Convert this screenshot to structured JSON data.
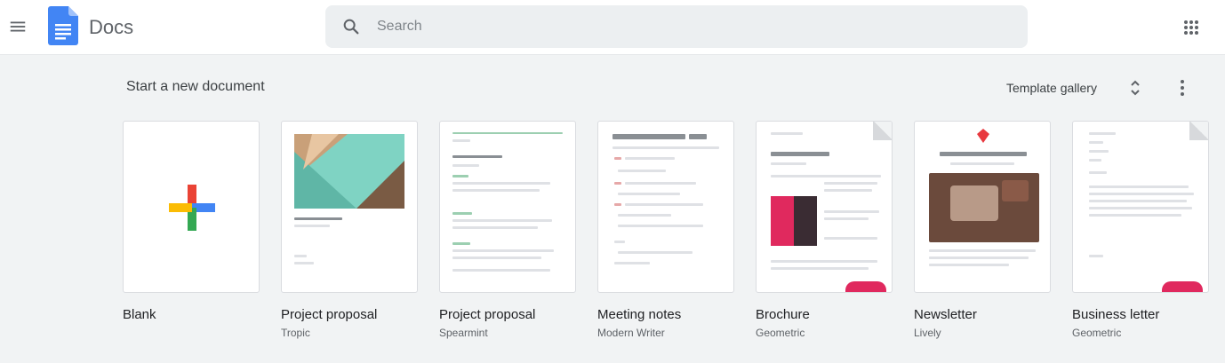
{
  "header": {
    "app_name": "Docs",
    "search_placeholder": "Search"
  },
  "templates": {
    "section_title": "Start a new document",
    "gallery_label": "Template gallery",
    "items": [
      {
        "name": "Blank",
        "subtitle": ""
      },
      {
        "name": "Project proposal",
        "subtitle": "Tropic"
      },
      {
        "name": "Project proposal",
        "subtitle": "Spearmint"
      },
      {
        "name": "Meeting notes",
        "subtitle": "Modern Writer"
      },
      {
        "name": "Brochure",
        "subtitle": "Geometric"
      },
      {
        "name": "Newsletter",
        "subtitle": "Lively"
      },
      {
        "name": "Business letter",
        "subtitle": "Geometric"
      }
    ]
  },
  "colors": {
    "docs_blue": "#4285f4",
    "plus_red": "#ea4335",
    "plus_yellow": "#fbbc04",
    "plus_green": "#34a853",
    "accent_pink": "#e0295e"
  }
}
